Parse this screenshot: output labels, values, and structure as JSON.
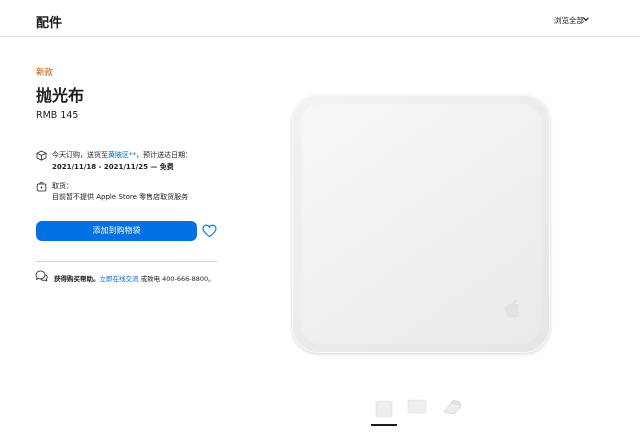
{
  "header": {
    "title": "配件",
    "browse_label": "浏览全部"
  },
  "product": {
    "tag": "新款",
    "name": "抛光布",
    "price": "RMB 145"
  },
  "delivery": {
    "line1_prefix": "今天订购，送货至",
    "line1_link": "黄陂区**",
    "line1_suffix": "，预计送达日期：",
    "dates": "2021/11/18 - 2021/11/25 — 免费"
  },
  "pickup": {
    "label": "取货：",
    "detail": "目前暂不提供 Apple Store 零售店取货服务"
  },
  "actions": {
    "add_to_bag": "添加到购物袋"
  },
  "help": {
    "bold": "获得购买帮助。",
    "link": "立即在线交流",
    "suffix": " 或致电 400-666-8800。"
  },
  "colors": {
    "accent": "#0071e3",
    "link": "#0066cc",
    "new_tag": "#bf4800"
  }
}
